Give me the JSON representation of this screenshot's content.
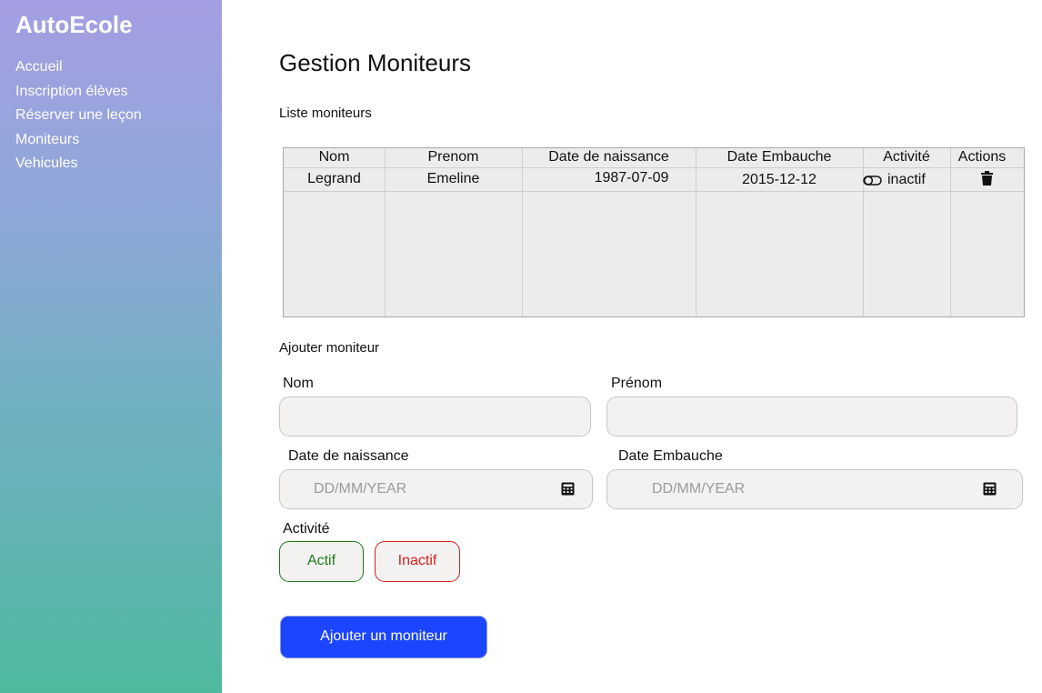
{
  "app": {
    "brand": "AutoEcole"
  },
  "sidebar": {
    "items": [
      {
        "label": "Accueil"
      },
      {
        "label": "Inscription élèves"
      },
      {
        "label": "Réserver une leçon"
      },
      {
        "label": "Moniteurs"
      },
      {
        "label": "Vehicules"
      }
    ]
  },
  "page": {
    "title": "Gestion Moniteurs"
  },
  "list": {
    "title": "Liste moniteurs",
    "columns": [
      "Nom",
      "Prenom",
      "Date de naissance",
      "Date Embauche",
      "Activité",
      "Actions"
    ],
    "rows": [
      {
        "nom": "Legrand",
        "prenom": "Emeline",
        "date_naissance": "1987-07-09",
        "date_embauche": "2015-12-12",
        "activite": "inactif",
        "activite_icon": "toggle-icon",
        "action_icon": "trash-icon"
      }
    ]
  },
  "form": {
    "title": "Ajouter moniteur",
    "nom": {
      "label": "Nom",
      "value": ""
    },
    "prenom": {
      "label": "Prénom",
      "value": ""
    },
    "date_naissance": {
      "label": "Date de naissance",
      "placeholder": "DD/MM/YEAR",
      "icon": "calendar-icon"
    },
    "date_embauche": {
      "label": "Date Embauche",
      "placeholder": "DD/MM/YEAR",
      "icon": "calendar-icon"
    },
    "activite": {
      "label": "Activité",
      "actif_label": "Actif",
      "inactif_label": "Inactif"
    },
    "submit_label": "Ajouter un moniteur"
  },
  "colors": {
    "primary_button": "#1b45ff",
    "actif": "#1d7a1d",
    "inactif": "#d62020"
  }
}
